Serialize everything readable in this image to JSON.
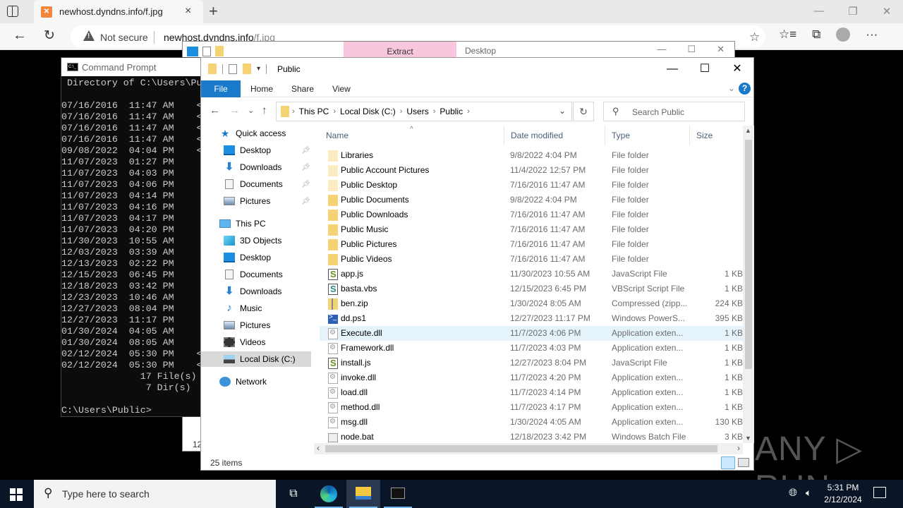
{
  "browser": {
    "tab_title": "newhost.dyndns.info/f.jpg",
    "security_label": "Not secure",
    "url_host": "newhost.dyndns.info",
    "url_path": "/f.jpg",
    "icons": {
      "tab_actions": "tab-actions-icon",
      "favicon": "xampp-favicon",
      "close": "×",
      "new_tab": "+",
      "back": "←",
      "reload": "↻",
      "add_favorite": "☆",
      "favorites": "☆≡",
      "collections": "⧉",
      "more": "···",
      "minimize": "—",
      "restore": "❐",
      "window_close": "✕"
    }
  },
  "back_explorer": {
    "ribbon_context_tab": "Extract",
    "title": "Desktop",
    "footer_text": "12",
    "controls": {
      "minimize": "—",
      "maximize": "☐",
      "close": "✕"
    }
  },
  "cmd": {
    "title": "Command Prompt",
    "lines": [
      " Directory of C:\\Users\\Pu",
      "",
      "07/16/2016  11:47 AM    <",
      "07/16/2016  11:47 AM    <",
      "07/16/2016  11:47 AM    <",
      "07/16/2016  11:47 AM    <",
      "09/08/2022  04:04 PM    <",
      "11/07/2023  01:27 PM",
      "11/07/2023  04:03 PM",
      "11/07/2023  04:06 PM",
      "11/07/2023  04:14 PM",
      "11/07/2023  04:16 PM",
      "11/07/2023  04:17 PM",
      "11/07/2023  04:20 PM",
      "11/30/2023  10:55 AM",
      "12/03/2023  03:39 AM",
      "12/13/2023  02:22 PM",
      "12/15/2023  06:45 PM",
      "12/18/2023  03:42 PM",
      "12/23/2023  10:46 AM",
      "12/27/2023  08:04 PM",
      "12/27/2023  11:17 PM",
      "01/30/2024  04:05 AM",
      "01/30/2024  08:05 AM",
      "02/12/2024  05:30 PM    <",
      "02/12/2024  05:30 PM    <",
      "              17 File(s)",
      "               7 Dir(s)",
      "",
      "C:\\Users\\Public>"
    ]
  },
  "explorer": {
    "title": "Public",
    "controls": {
      "minimize": "—",
      "maximize": "☐",
      "close": "✕"
    },
    "ribbon": {
      "file": "File",
      "tabs": [
        "Home",
        "Share",
        "View"
      ],
      "expand": "⌄",
      "help": "?"
    },
    "nav": {
      "back": "←",
      "forward": "→",
      "recent": "⌄",
      "up": "↑",
      "refresh": "↻",
      "dropdown": "⌄"
    },
    "breadcrumb": [
      "This PC",
      "Local Disk (C:)",
      "Users",
      "Public"
    ],
    "search_placeholder": "Search Public",
    "sidebar": [
      {
        "label": "Quick access",
        "icon": "star-icon",
        "level": 0
      },
      {
        "label": "Desktop",
        "icon": "desktop-icon",
        "level": 1,
        "pinned": true
      },
      {
        "label": "Downloads",
        "icon": "download-icon",
        "level": 1,
        "pinned": true
      },
      {
        "label": "Documents",
        "icon": "documents-icon",
        "level": 1,
        "pinned": true
      },
      {
        "label": "Pictures",
        "icon": "pictures-icon",
        "level": 1,
        "pinned": true
      },
      {
        "label": "This PC",
        "icon": "this-pc-icon",
        "level": 0
      },
      {
        "label": "3D Objects",
        "icon": "3d-objects-icon",
        "level": 1
      },
      {
        "label": "Desktop",
        "icon": "desktop-icon",
        "level": 1
      },
      {
        "label": "Documents",
        "icon": "documents-icon",
        "level": 1
      },
      {
        "label": "Downloads",
        "icon": "download-icon",
        "level": 1
      },
      {
        "label": "Music",
        "icon": "music-icon",
        "level": 1
      },
      {
        "label": "Pictures",
        "icon": "pictures-icon",
        "level": 1
      },
      {
        "label": "Videos",
        "icon": "videos-icon",
        "level": 1
      },
      {
        "label": "Local Disk (C:)",
        "icon": "local-disk-icon",
        "level": 1,
        "selected": true
      },
      {
        "label": "Network",
        "icon": "network-icon",
        "level": 0
      }
    ],
    "columns": {
      "name": "Name",
      "date": "Date modified",
      "type": "Type",
      "size": "Size"
    },
    "files": [
      {
        "name": "Libraries",
        "date": "9/8/2022 4:04 PM",
        "type": "File folder",
        "size": "",
        "icon": "folder-light"
      },
      {
        "name": "Public Account Pictures",
        "date": "11/4/2022 12:57 PM",
        "type": "File folder",
        "size": "",
        "icon": "folder-light"
      },
      {
        "name": "Public Desktop",
        "date": "7/16/2016 11:47 AM",
        "type": "File folder",
        "size": "",
        "icon": "folder-light"
      },
      {
        "name": "Public Documents",
        "date": "9/8/2022 4:04 PM",
        "type": "File folder",
        "size": "",
        "icon": "folder"
      },
      {
        "name": "Public Downloads",
        "date": "7/16/2016 11:47 AM",
        "type": "File folder",
        "size": "",
        "icon": "folder"
      },
      {
        "name": "Public Music",
        "date": "7/16/2016 11:47 AM",
        "type": "File folder",
        "size": "",
        "icon": "folder"
      },
      {
        "name": "Public Pictures",
        "date": "7/16/2016 11:47 AM",
        "type": "File folder",
        "size": "",
        "icon": "folder"
      },
      {
        "name": "Public Videos",
        "date": "7/16/2016 11:47 AM",
        "type": "File folder",
        "size": "",
        "icon": "folder"
      },
      {
        "name": "app.js",
        "date": "11/30/2023 10:55 AM",
        "type": "JavaScript File",
        "size": "1 KB",
        "icon": "js"
      },
      {
        "name": "basta.vbs",
        "date": "12/15/2023 6:45 PM",
        "type": "VBScript Script File",
        "size": "1 KB",
        "icon": "vbs"
      },
      {
        "name": "ben.zip",
        "date": "1/30/2024 8:05 AM",
        "type": "Compressed (zipp...",
        "size": "224 KB",
        "icon": "zip"
      },
      {
        "name": "dd.ps1",
        "date": "12/27/2023 11:17 PM",
        "type": "Windows PowerS...",
        "size": "395 KB",
        "icon": "ps1"
      },
      {
        "name": "Execute.dll",
        "date": "11/7/2023 4:06 PM",
        "type": "Application exten...",
        "size": "1 KB",
        "icon": "dll",
        "hover": true
      },
      {
        "name": "Framework.dll",
        "date": "11/7/2023 4:03 PM",
        "type": "Application exten...",
        "size": "1 KB",
        "icon": "dll"
      },
      {
        "name": "install.js",
        "date": "12/27/2023 8:04 PM",
        "type": "JavaScript File",
        "size": "1 KB",
        "icon": "js"
      },
      {
        "name": "invoke.dll",
        "date": "11/7/2023 4:20 PM",
        "type": "Application exten...",
        "size": "1 KB",
        "icon": "dll"
      },
      {
        "name": "load.dll",
        "date": "11/7/2023 4:14 PM",
        "type": "Application exten...",
        "size": "1 KB",
        "icon": "dll"
      },
      {
        "name": "method.dll",
        "date": "11/7/2023 4:17 PM",
        "type": "Application exten...",
        "size": "1 KB",
        "icon": "dll"
      },
      {
        "name": "msg.dll",
        "date": "1/30/2024 4:05 AM",
        "type": "Application exten...",
        "size": "130 KB",
        "icon": "dll"
      },
      {
        "name": "node.bat",
        "date": "12/18/2023 3:42 PM",
        "type": "Windows Batch File",
        "size": "3 KB",
        "icon": "bat"
      }
    ],
    "status": "25 items"
  },
  "watermark": "ANY ▷ RUN",
  "taskbar": {
    "search_placeholder": "Type here to search",
    "time": "5:31 PM",
    "date": "2/12/2024",
    "apps": [
      "task-view",
      "edge",
      "file-explorer",
      "command-prompt"
    ]
  }
}
